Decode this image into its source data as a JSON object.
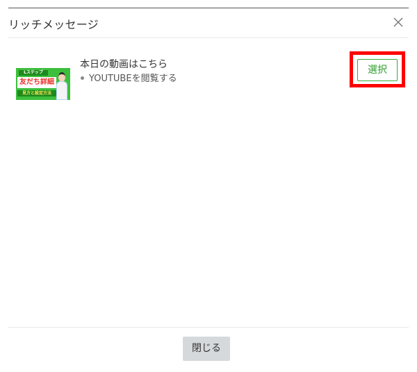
{
  "modal": {
    "title": "リッチメッセージ",
    "footer": {
      "close_label": "閉じる"
    }
  },
  "items": [
    {
      "title": "本日の動画はこちら",
      "subtitle": "YOUTUBEを閲覧する",
      "select_label": "選択",
      "thumbnail": {
        "tag": "Lステップ",
        "banner": "友だち詳細",
        "sub": "見方と設定方法",
        "background": "#3cbf3c"
      }
    }
  ],
  "colors": {
    "accent_green": "#2e9e2e",
    "highlight_red": "#ff0000",
    "footer_button_bg": "#d6d9dc"
  },
  "icons": {
    "close": "close-icon",
    "bullet": "bullet-icon"
  }
}
